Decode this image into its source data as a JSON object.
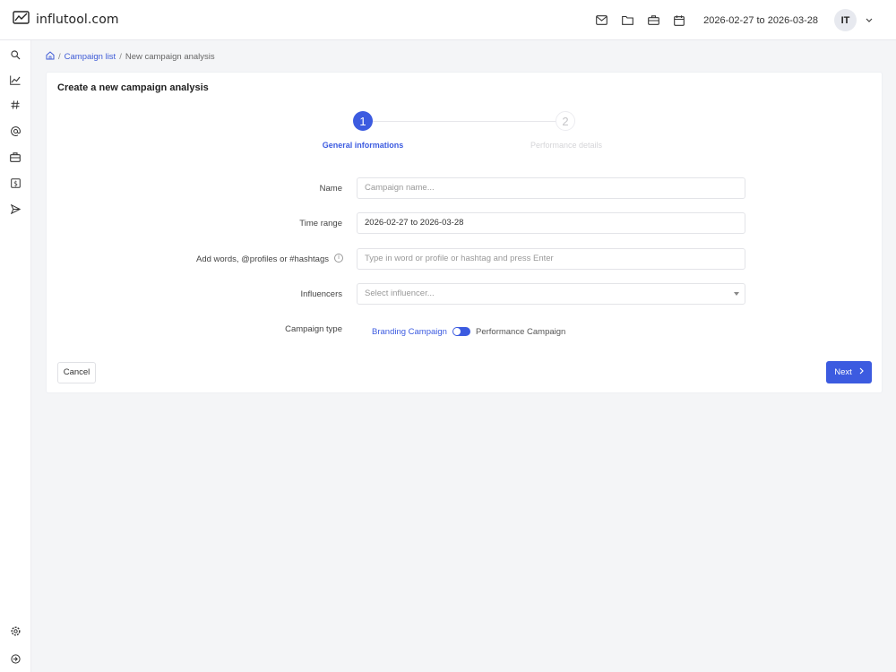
{
  "app": {
    "logo_text": "influtool.com"
  },
  "topbar": {
    "icons": [
      "mail-icon",
      "folder-icon",
      "briefcase-icon",
      "calendar-icon"
    ],
    "date_range": "2026-02-27 to 2026-03-28",
    "avatar_initials": "IT"
  },
  "sidebar": {
    "items": [
      "search-icon",
      "chart-icon",
      "hashtag-icon",
      "at-icon",
      "briefcase-icon",
      "dollar-icon",
      "send-icon"
    ],
    "bottom": [
      "settings-icon",
      "logout-icon"
    ]
  },
  "breadcrumb": {
    "sep": "/",
    "link": "Campaign list",
    "current": "New campaign analysis"
  },
  "card": {
    "title": "Create a new campaign analysis"
  },
  "stepper": {
    "steps": [
      {
        "number": "1",
        "label": "General informations"
      },
      {
        "number": "2",
        "label": "Performance details"
      }
    ]
  },
  "form": {
    "name": {
      "label": "Name",
      "placeholder": "Campaign name..."
    },
    "time_range": {
      "label": "Time range",
      "value": "2026-02-27 to 2026-03-28"
    },
    "words": {
      "label": "Add words, @profiles or #hashtags",
      "placeholder": "Type in word or profile or hashtag and press Enter",
      "info": "i"
    },
    "influencers": {
      "label": "Influencers",
      "placeholder": "Select influencer..."
    },
    "campaign_type": {
      "label": "Campaign type",
      "option_a": "Branding Campaign",
      "option_b": "Performance Campaign"
    }
  },
  "buttons": {
    "cancel": "Cancel",
    "next": "Next"
  },
  "colors": {
    "accent": "#3c5be0"
  }
}
